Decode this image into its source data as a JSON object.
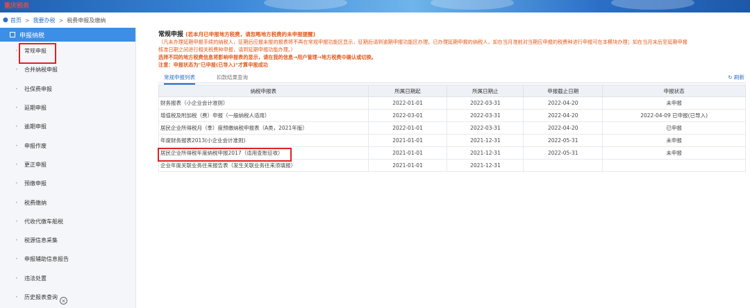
{
  "header": {
    "logo_text": "重庆税务"
  },
  "breadcrumb": {
    "items": [
      "首页",
      "我要办税",
      "税费申报及缴纳"
    ]
  },
  "sidebar": {
    "title": "申报纳税",
    "items": [
      {
        "label": "常规申报"
      },
      {
        "label": "合并纳税申报"
      },
      {
        "label": "社保费申报"
      },
      {
        "label": "延期申报"
      },
      {
        "label": "逾期申报"
      },
      {
        "label": "申报作废"
      },
      {
        "label": "更正申报"
      },
      {
        "label": "预缴申报"
      },
      {
        "label": "税费缴纳"
      },
      {
        "label": "代收代缴车船税"
      },
      {
        "label": "税源信息采集"
      },
      {
        "label": "申报辅助信息报告"
      },
      {
        "label": "违法处置"
      },
      {
        "label": "历史报表查询"
      }
    ]
  },
  "main": {
    "title": "常规申报",
    "title_tip": "(若本月已申报地方税费，请忽略地方税费的未申报提醒)",
    "notice_line1": "（凡未办理延期申报手续的纳税人，征期后应报未报的报表将不再在常规申报功能区显示，征期后请到逾期申报功能区办理。已办理延期申报的纳税人，如在当月准前对当期应申报的税费种进行申报可在本模块办理；如在当月末后至延期申报",
    "notice_line2": "核准日期之间进行相关税费种申报，请到延期申报功能办理。）",
    "notice_line3": "选择不同的地方税费信息将影响申报表的显示，请在我的信息→用户管理→地方税费中确认或切换。",
    "note_prefix": "注意：",
    "note_text": "申报状态为\"已申报(已导入)\"才算申报成功",
    "tabs": [
      "常规申报列表",
      "扣款结果查询"
    ],
    "refresh_label": "刷新"
  },
  "table": {
    "headers": [
      "纳税申报表",
      "所属日期起",
      "所属日期止",
      "申报截止日期",
      "申报状态"
    ],
    "rows": [
      {
        "name": "财务报表（小企业会计准则）",
        "start": "2022-01-01",
        "end": "2022-03-31",
        "deadline": "2022-04-20",
        "status": "未申报"
      },
      {
        "name": "增值税及附加税（费）申报（一般纳税人适用）",
        "start": "2022-03-01",
        "end": "2022-03-31",
        "deadline": "2022-04-20",
        "status": "2022-04-09 已申报(已导入)"
      },
      {
        "name": "居民企业所得税月（季）度预缴纳税申报表（A类，2021年版）",
        "start": "2022-01-01",
        "end": "2022-03-31",
        "deadline": "2022-04-20",
        "status": "已申报"
      },
      {
        "name": "年度财务报表2013(小企业会计准则)",
        "start": "2021-01-01",
        "end": "2021-12-31",
        "deadline": "2022-05-31",
        "status": "未申报"
      },
      {
        "name": "居民企业所得税年度纳税申报2017（适用查账征收）",
        "start": "2021-01-01",
        "end": "2021-12-31",
        "deadline": "2022-05-31",
        "status": "未申报"
      },
      {
        "name": "企业年度关联业务往来报告表（发生关联业务往来须填报）",
        "start": "2021-01-01",
        "end": "2021-12-31",
        "deadline": "",
        "status": ""
      }
    ]
  }
}
